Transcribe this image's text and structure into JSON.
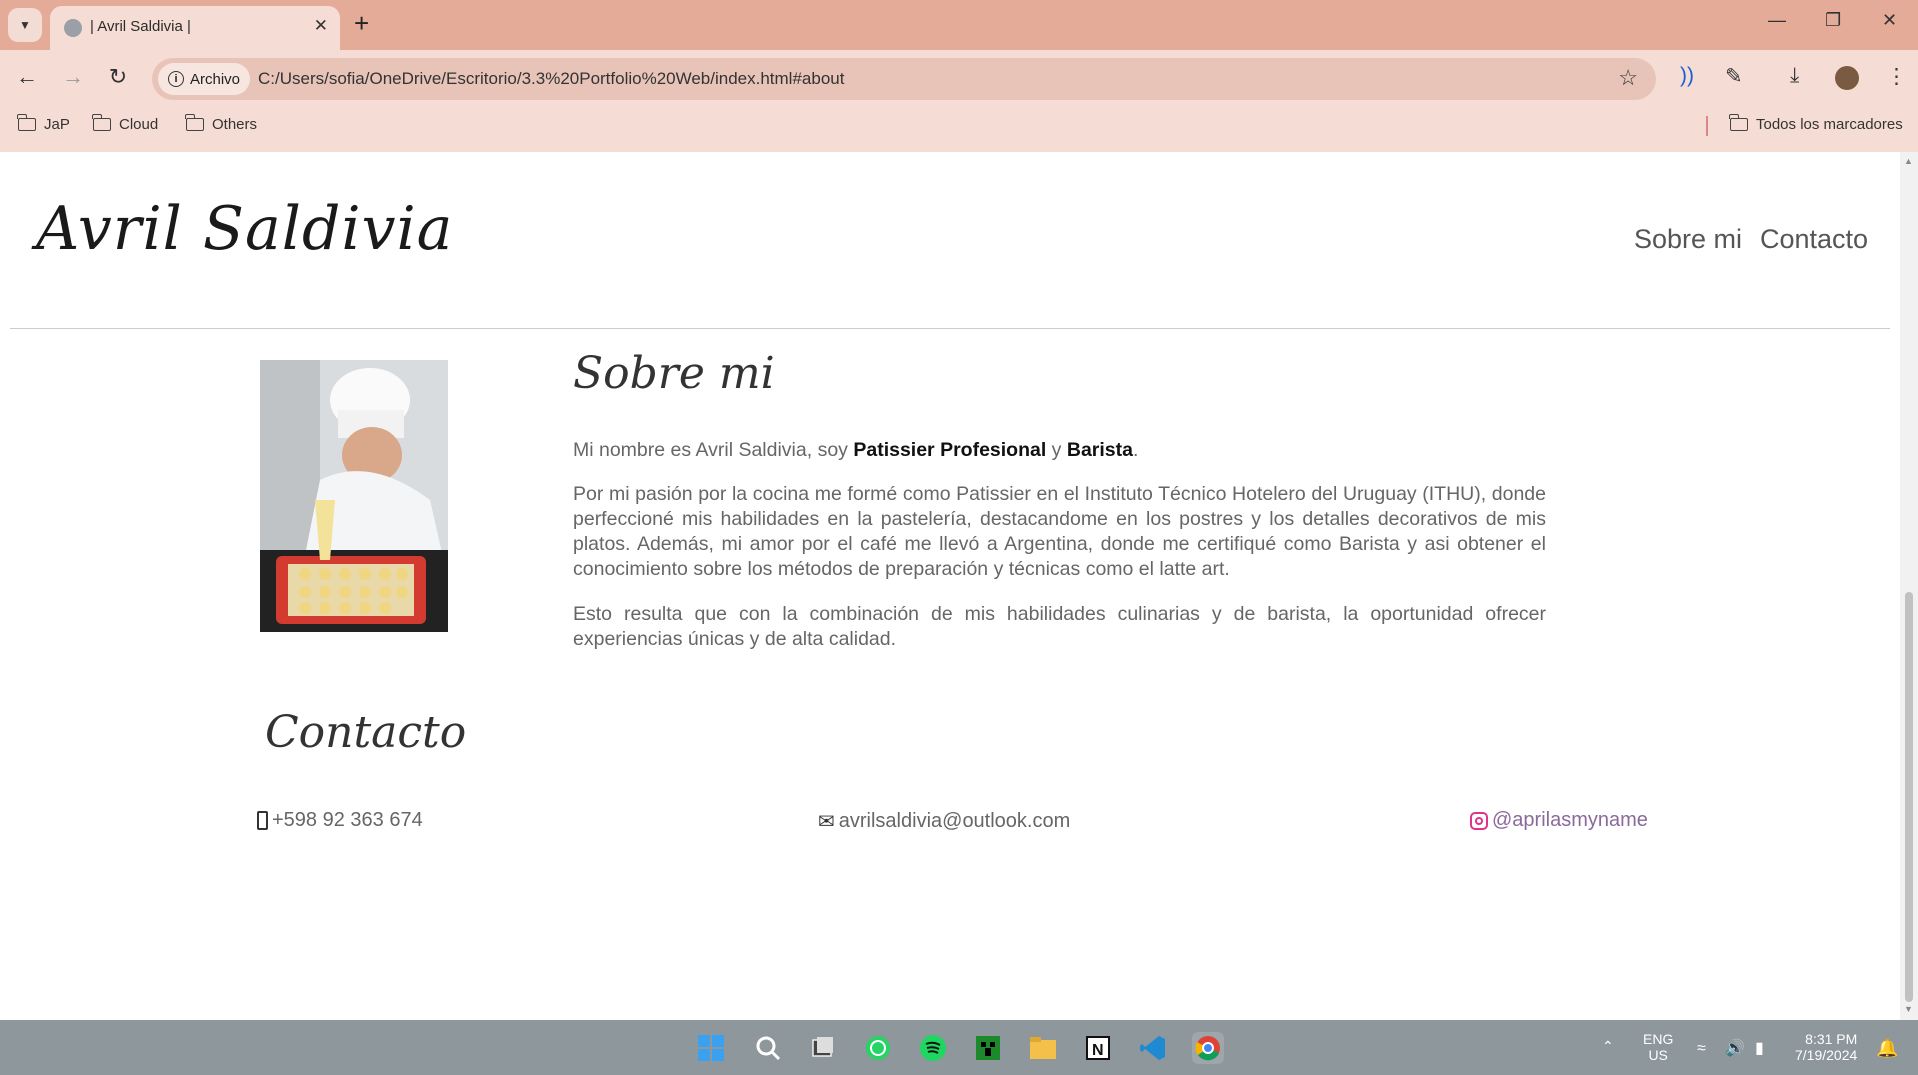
{
  "browser": {
    "tab_title": "| Avril Saldivia |",
    "site_chip_label": "Archivo",
    "url": "C:/Users/sofia/OneDrive/Escritorio/3.3%20Portfolio%20Web/index.html#about",
    "bookmarks": [
      "JaP",
      "Cloud",
      "Others"
    ],
    "all_bookmarks_label": "Todos los marcadores"
  },
  "header": {
    "logo": "Avril Saldivia",
    "nav": [
      "Sobre mi",
      "Contacto"
    ]
  },
  "about": {
    "title": "Sobre mi",
    "intro_prefix": "Mi nombre es Avril Saldivia, soy ",
    "intro_bold1": "Patissier Profesional",
    "intro_mid": " y ",
    "intro_bold2": "Barista",
    "intro_suffix": ".",
    "para2": "Por mi pasión por la cocina me formé como Patissier en el Instituto Técnico Hotelero del Uruguay (ITHU), donde perfeccioné mis habilidades en la pastelería, destacandome en los postres y los detalles decorativos de mis platos. Además, mi amor por el café me llevó a Argentina, donde me certifiqué como Barista y asi obtener el conocimiento sobre los métodos de preparación y técnicas como el latte art.",
    "para3": "Esto resulta que con la combinación de mis habilidades culinarias y de barista, la oportunidad ofrecer experiencias únicas y de alta calidad."
  },
  "contact": {
    "title": "Contacto",
    "phone": "+598 92 363 674",
    "email": "avrilsaldivia@outlook.com",
    "instagram": "@aprilasmyname"
  },
  "taskbar": {
    "lang_top": "ENG",
    "lang_bottom": "US",
    "time": "8:31 PM",
    "date": "7/19/2024"
  },
  "colors": {
    "tabbar": "#e4ab99",
    "toolbar": "#f5ddd5",
    "instagram_text": "#8a6a9a"
  }
}
